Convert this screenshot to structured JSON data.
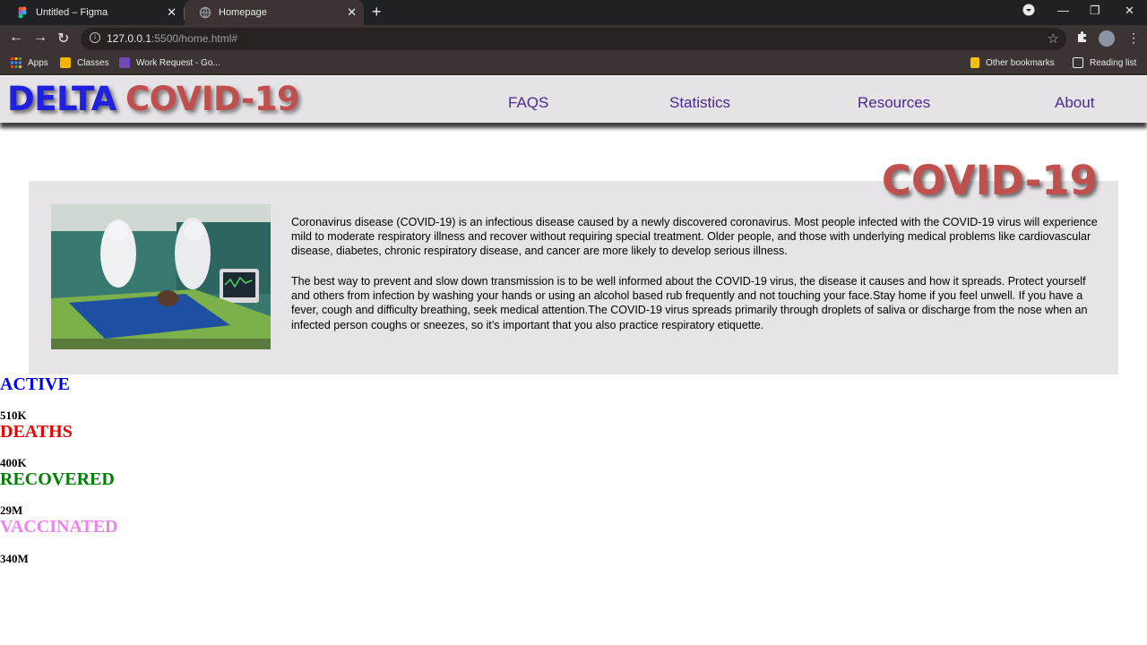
{
  "browser": {
    "tabs": [
      {
        "title": "Untitled – Figma",
        "icon": "figma-icon"
      },
      {
        "title": "Homepage",
        "icon": "globe-icon"
      }
    ],
    "url_host": "127.0.0.1",
    "url_path": ":5500/home.html#",
    "bookmarks": [
      {
        "label": "Apps",
        "icon": "apps-grid-icon"
      },
      {
        "label": "Classes",
        "icon": "classroom-icon"
      },
      {
        "label": "Work Request - Go...",
        "icon": "forms-icon"
      }
    ],
    "other_bookmarks": "Other bookmarks",
    "reading_list": "Reading list"
  },
  "site": {
    "logo_part1": "DELTA",
    "logo_part2": "COVID-19",
    "nav": [
      "FAQS",
      "Statistics",
      "Resources",
      "About"
    ]
  },
  "hero": {
    "title": "COVID-19",
    "paragraph1": "Coronavirus disease (COVID-19) is an infectious disease caused by a newly discovered coronavirus. Most people infected with the COVID-19 virus will experience mild to moderate respiratory illness and recover without requiring special treatment. Older people, and those with underlying medical problems like cardiovascular disease, diabetes, chronic respiratory disease, and cancer are more likely to develop serious illness.",
    "paragraph2": "The best way to prevent and slow down transmission is to be well informed about the COVID-19 virus, the disease it causes and how it spreads. Protect yourself and others from infection by washing your hands or using an alcohol based rub frequently and not touching your face.Stay home if you feel unwell. If you have a fever, cough and difficulty breathing, seek medical attention.The COVID-19 virus spreads primarily through droplets of saliva or discharge from the nose when an infected person coughs or sneezes, so it’s important that you also practice respiratory etiquette."
  },
  "stats": [
    {
      "label": "ACTIVE",
      "value": "510K",
      "color": "#0000ee"
    },
    {
      "label": "DEATHS",
      "value": "400K",
      "color": "#ee0000"
    },
    {
      "label": "RECOVERED",
      "value": "29M",
      "color": "#008000"
    },
    {
      "label": "VACCINATED",
      "value": "340M",
      "color": "#ee82ee"
    }
  ]
}
